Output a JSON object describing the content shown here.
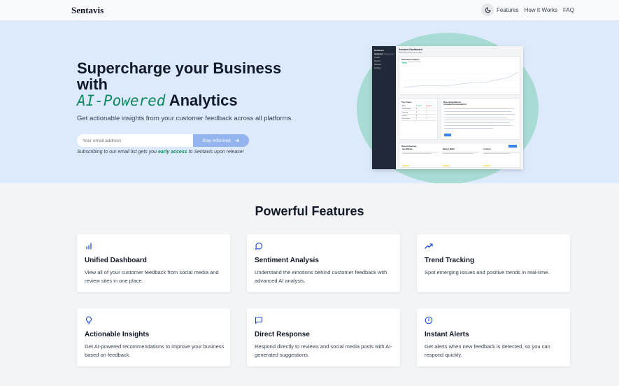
{
  "header": {
    "brand": "Sentavis",
    "nav": [
      "Features",
      "How It Works",
      "FAQ"
    ]
  },
  "hero": {
    "title_line1": "Supercharge your Business",
    "title_line2": "with",
    "title_ai": "AI-Powered",
    "title_analytics": " Analytics",
    "subtitle": "Get actionable insights from your customer feedback across all platforms.",
    "email_placeholder": "Your email address",
    "button_label": "Stay Informed",
    "note_before": "Subscribing to our email list gets you ",
    "note_highlight": "early access",
    "note_after": " to Sentavis upon release!"
  },
  "dashboard": {
    "sidebar_items": [
      "Dashboard",
      "Sentiment",
      "Trends",
      "Reports",
      "Reviews",
      "Settings"
    ],
    "title": "Sentavis Dashboard",
    "range": "Select time period    Last 30 days",
    "sentiment_label": "Sentiment Analysis",
    "sentiment_value": "78%",
    "sentiment_sub": "Positive sentiment",
    "topics_label": "Top Topics",
    "topics_headers": [
      "Topic",
      "Positive",
      "Negative"
    ],
    "topics_rows": [
      [
        "Food Quality",
        "8",
        "2"
      ],
      [
        "Ordering",
        "5",
        "3"
      ],
      [
        "Service",
        "6",
        "1"
      ],
      [
        "Store Hours",
        "4",
        "2"
      ]
    ],
    "recommendations_label": "Recommendations",
    "recommendations_sub": "Actionable Recommendations",
    "reviews_label": "Recent Reviews",
    "reviewers": [
      "Alex Williams",
      "Madison Walker",
      "Jo Garcia"
    ]
  },
  "features": {
    "heading": "Powerful Features",
    "items": [
      {
        "icon": "bar-chart-icon",
        "title": "Unified Dashboard",
        "desc": "View all of your customer feedback from social media and review sites in one place."
      },
      {
        "icon": "chat-bubble-icon",
        "title": "Sentiment Analysis",
        "desc": "Understand the emotions behind customer feedback with advanced AI analysis."
      },
      {
        "icon": "trend-up-icon",
        "title": "Trend Tracking",
        "desc": "Spot emerging issues and positive trends in real-time."
      },
      {
        "icon": "lightbulb-icon",
        "title": "Actionable Insights",
        "desc": "Get AI-powered recommendations to improve your business based on feedback."
      },
      {
        "icon": "message-square-icon",
        "title": "Direct Response",
        "desc": "Respond directly to reviews and social media posts with AI-generated suggestions."
      },
      {
        "icon": "alert-circle-icon",
        "title": "Instant Alerts",
        "desc": "Get alerts when new feedback is detected, so you can respond quickly."
      }
    ]
  },
  "colors": {
    "accent_green": "#0f8a5f",
    "hero_bg": "#dceafb",
    "button_blue": "#93b4ee",
    "icon_blue": "#1d4ed8"
  }
}
